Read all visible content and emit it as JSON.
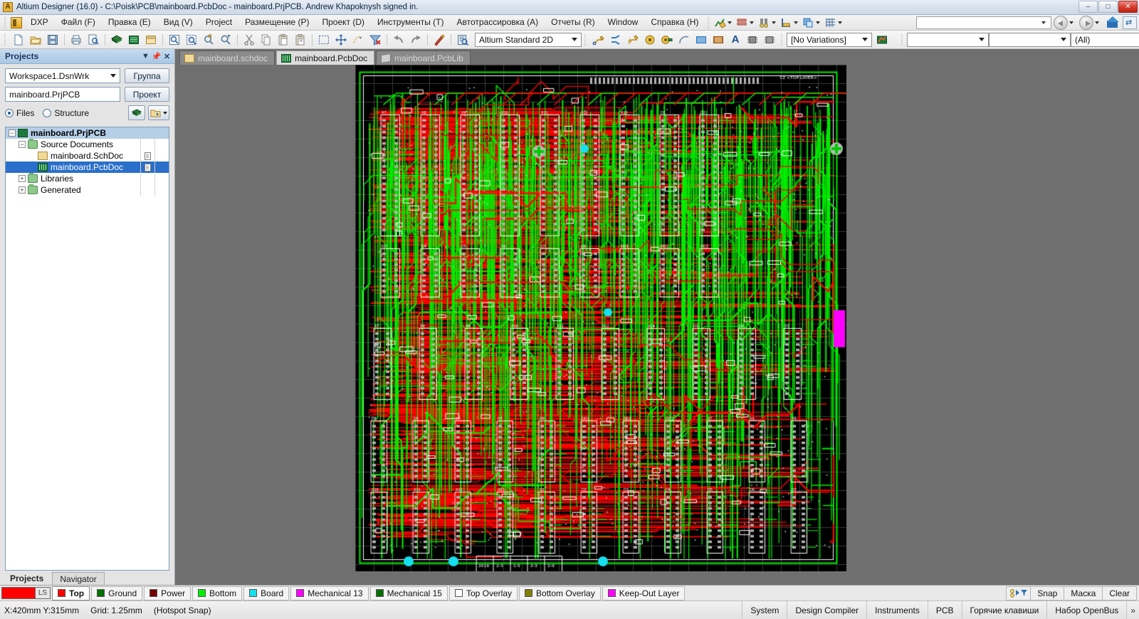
{
  "window": {
    "title": "Altium Designer (16.0) - C:\\Poisk\\PCB\\mainboard.PcbDoc - mainboard.PrjPCB. Andrew Khapoknysh signed in.",
    "app_icon": "A",
    "minimize": "–",
    "maximize": "□",
    "close": "✕"
  },
  "menu": {
    "dxp": "DXP",
    "items": [
      "Файл (F)",
      "Правка (E)",
      "Вид (V)",
      "Project",
      "Размещение (P)",
      "Проект (D)",
      "Инструменты (T)",
      "Автотрассировка (A)",
      "Отчеты (R)",
      "Window",
      "Справка (H)"
    ],
    "right_combo_value": ""
  },
  "toolbar": {
    "view_config_value": "Altium Standard 2D",
    "variations_value": "[No Variations]",
    "filter_combo1": "",
    "filter_combo2": "",
    "filter_all": "(All)"
  },
  "projects_panel": {
    "title": "Projects",
    "workspace_value": "Workspace1.DsnWrk",
    "group_button": "Группа",
    "project_value": "mainboard.PrjPCB",
    "project_button": "Проект",
    "radio_files": "Files",
    "radio_structure": "Structure",
    "selected_radio": "Files",
    "tree": [
      {
        "label": "mainboard.PrjPCB",
        "icon": "pcb-project-icon",
        "indent": 0,
        "expander": "−",
        "selected": false,
        "highlight": true,
        "bold": true,
        "doc": false
      },
      {
        "label": "Source Documents",
        "icon": "folder-icon",
        "indent": 1,
        "expander": "−",
        "selected": false,
        "highlight": false,
        "bold": false,
        "doc": false
      },
      {
        "label": "mainboard.SchDoc",
        "icon": "schematic-icon",
        "indent": 2,
        "expander": "",
        "selected": false,
        "highlight": false,
        "bold": false,
        "doc": true
      },
      {
        "label": "mainboard.PcbDoc",
        "icon": "pcb-icon",
        "indent": 2,
        "expander": "",
        "selected": true,
        "highlight": false,
        "bold": false,
        "doc": true
      },
      {
        "label": "Libraries",
        "icon": "folder-icon",
        "indent": 1,
        "expander": "+",
        "selected": false,
        "highlight": false,
        "bold": false,
        "doc": false
      },
      {
        "label": "Generated",
        "icon": "folder-icon",
        "indent": 1,
        "expander": "+",
        "selected": false,
        "highlight": false,
        "bold": false,
        "doc": false
      }
    ],
    "tabs": [
      {
        "label": "Projects",
        "active": true
      },
      {
        "label": "Navigator",
        "active": false
      }
    ]
  },
  "document_tabs": [
    {
      "label": "mainboard.schdoc",
      "icon": "schematic-icon",
      "active": false
    },
    {
      "label": "mainboard.PcbDoc",
      "icon": "pcb-icon",
      "active": true
    },
    {
      "label": "mainboard.PcbLib",
      "icon": "pcblib-icon",
      "active": false
    }
  ],
  "layer_bar": {
    "active_color": "#ff0000",
    "ls_label": "LS",
    "layers": [
      {
        "label": "Top",
        "color": "#ff0000",
        "active": true
      },
      {
        "label": "Ground",
        "color": "#007000",
        "active": false
      },
      {
        "label": "Power",
        "color": "#730000",
        "active": false
      },
      {
        "label": "Bottom",
        "color": "#00ee00",
        "active": false
      },
      {
        "label": "Board",
        "color": "#17e0ee",
        "active": false
      },
      {
        "label": "Mechanical 13",
        "color": "#ff00ff",
        "active": false
      },
      {
        "label": "Mechanical 15",
        "color": "#007000",
        "active": false
      },
      {
        "label": "Top Overlay",
        "color": "#ffffff",
        "active": false
      },
      {
        "label": "Bottom Overlay",
        "color": "#808000",
        "active": false
      },
      {
        "label": "Keep-Out Layer",
        "color": "#ff00ff",
        "active": false
      }
    ],
    "right_buttons": [
      "Snap",
      "Маска",
      "Clear"
    ]
  },
  "status_bar": {
    "coords": "X:420mm Y:315mm",
    "grid": "Grid: 1.25mm",
    "mode": "(Hotspot Snap)",
    "buttons": [
      "System",
      "Design Compiler",
      "Instruments",
      "PCB",
      "Горячие клавиши",
      "Набор OpenBus"
    ],
    "chevron": "»"
  },
  "pcb_canvas": {
    "background": "#000000",
    "grid_color": "#3a3a3a",
    "trace_top_color": "#ff0000",
    "trace_bottom_color": "#00ee00",
    "silk_color": "#ffffff",
    "pad_color": "#b4b4b4"
  }
}
